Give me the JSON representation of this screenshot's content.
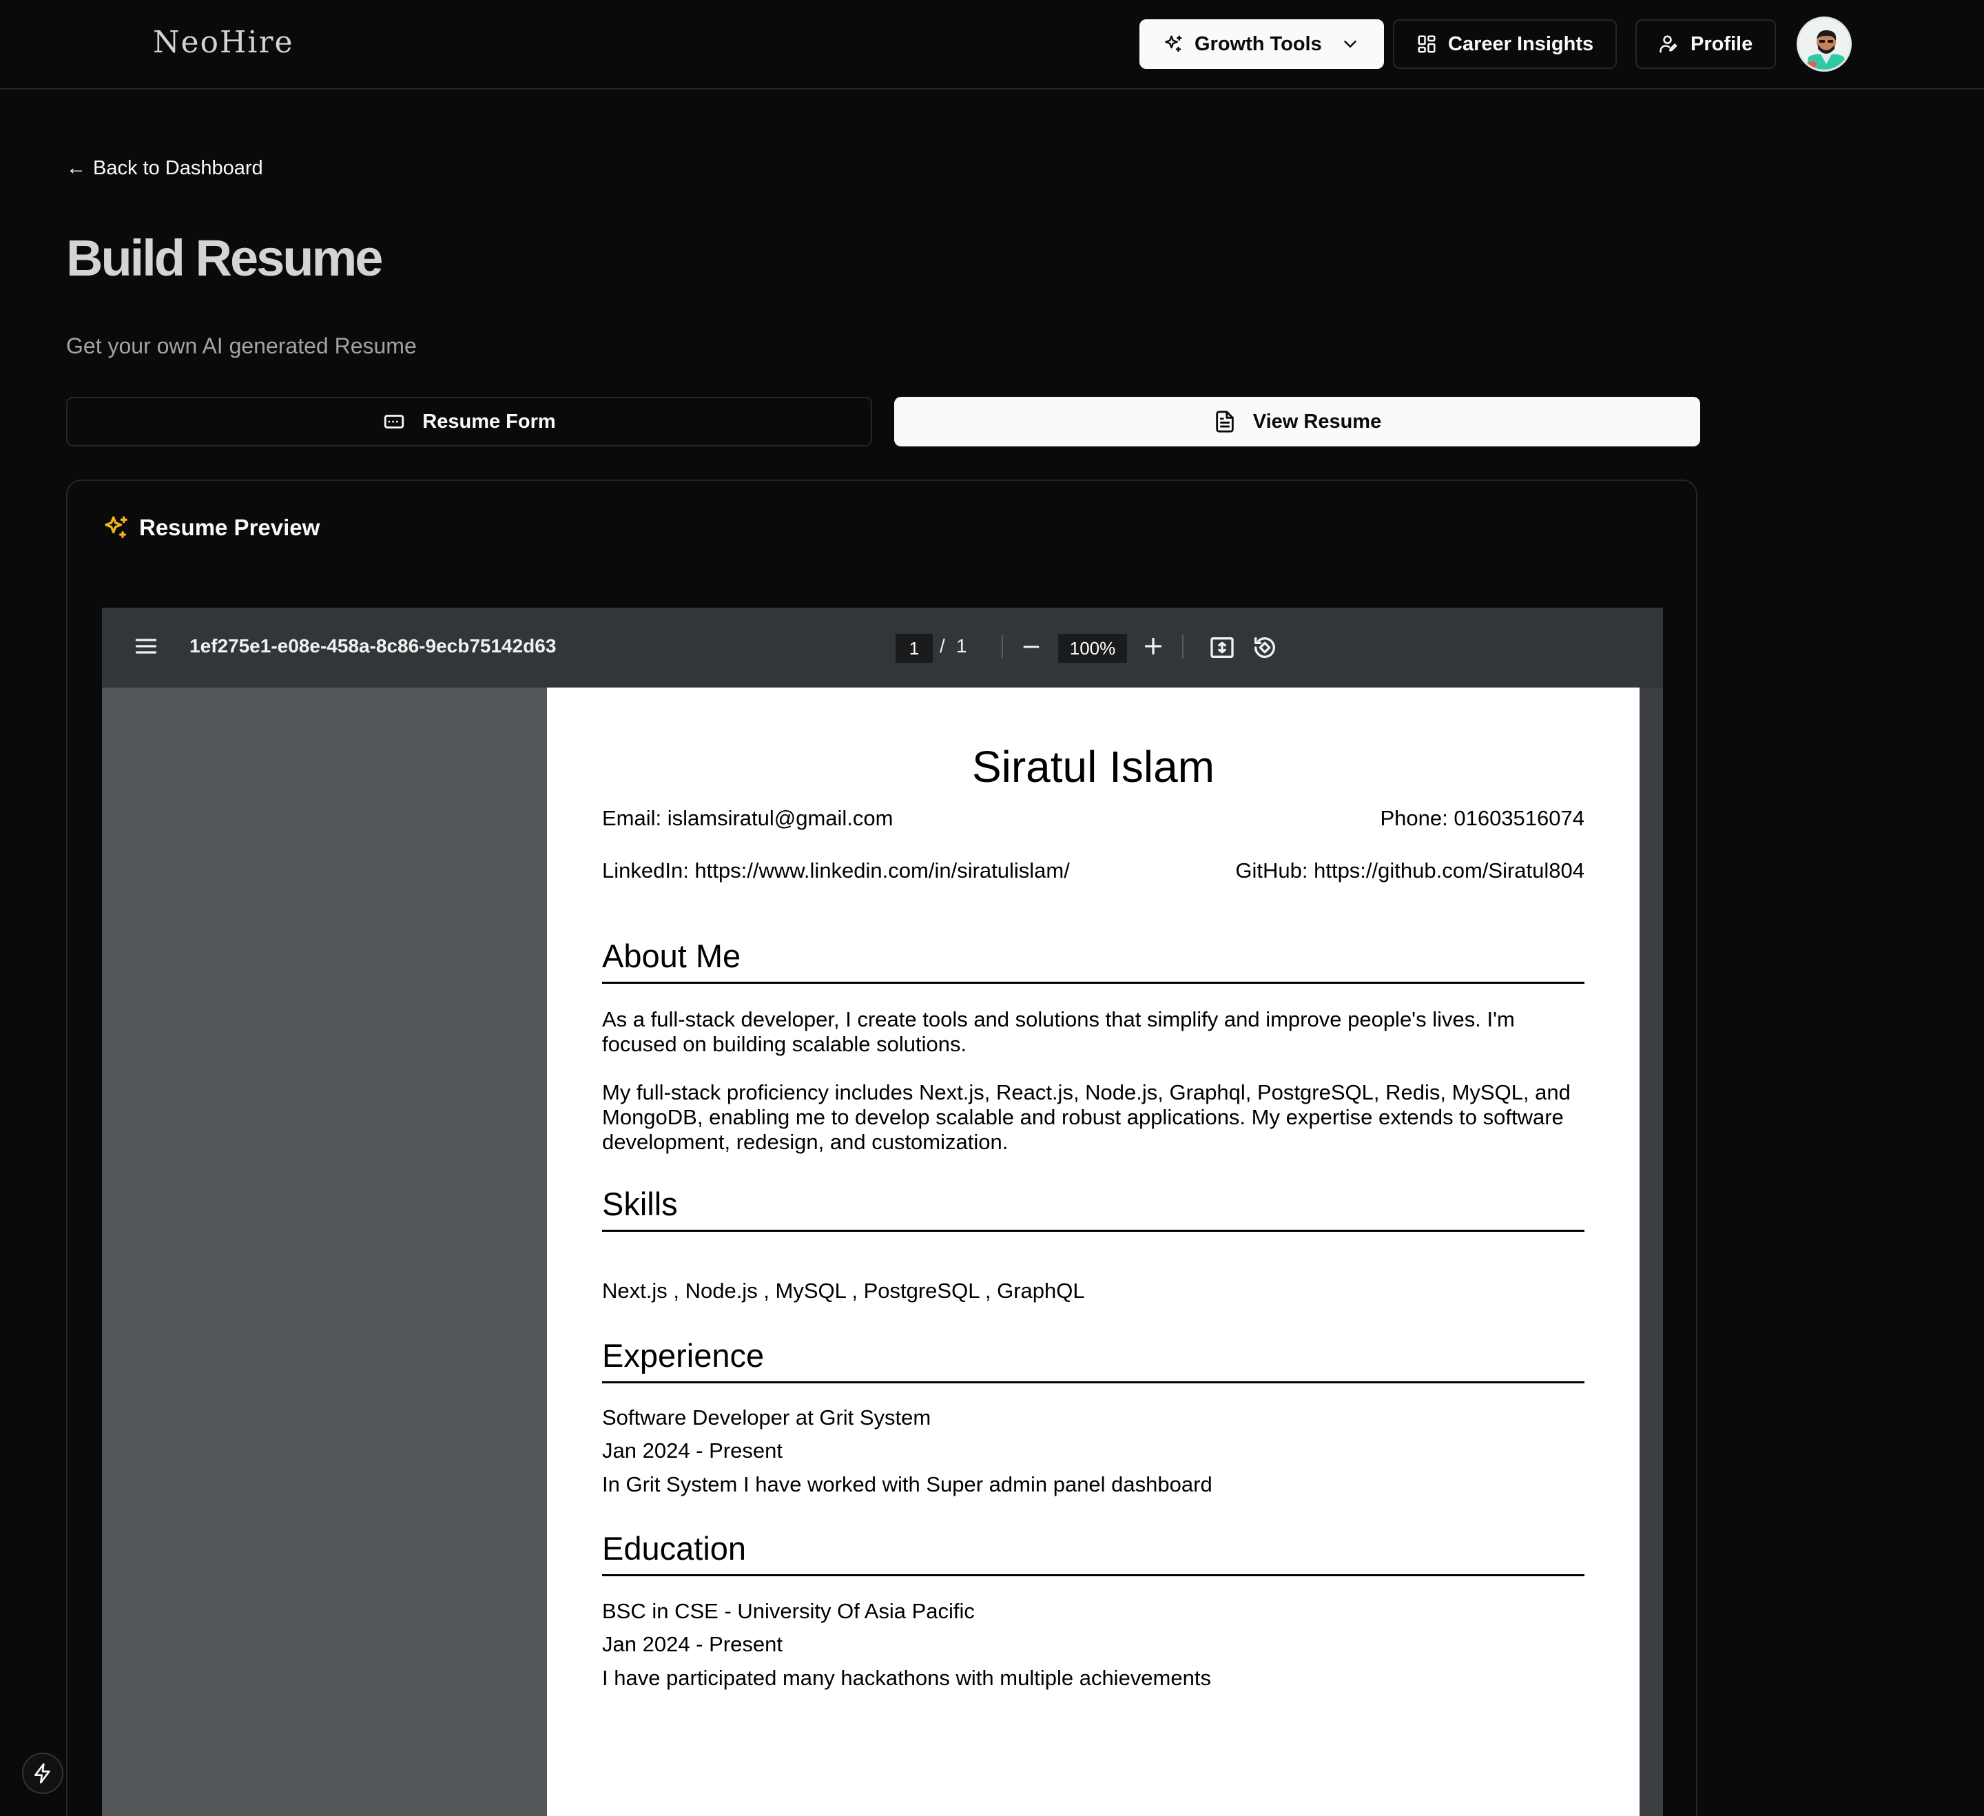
{
  "app": {
    "logo": "NeoHire"
  },
  "nav": {
    "growth_tools": "Growth Tools",
    "career_insights": "Career Insights",
    "profile": "Profile"
  },
  "header": {
    "back_link": "Back to Dashboard",
    "back_arrow": "←",
    "title": "Build Resume",
    "subtitle": "Get your own AI generated Resume"
  },
  "tabs": [
    {
      "label": "Resume Form",
      "icon": "form-icon",
      "active": false
    },
    {
      "label": "View Resume",
      "icon": "file-icon",
      "active": true
    }
  ],
  "card": {
    "title": "Resume Preview",
    "icon": "sparkles-icon",
    "icon_color": "#f5b31b"
  },
  "viewer": {
    "doc_name": "1ef275e1-e08e-458a-8c86-9ecb75142d63",
    "page_current": "1",
    "page_separator": "/",
    "page_total": "1",
    "zoom": "100%"
  },
  "resume": {
    "name": "Siratul Islam",
    "email": "Email: islamsiratul@gmail.com",
    "phone": "Phone: 01603516074",
    "linkedin": "LinkedIn: https://www.linkedin.com/in/siratulislam/",
    "github": "GitHub: https://github.com/Siratul804",
    "about_heading": "About Me",
    "about_p1": "As a full-stack developer, I create tools and solutions that simplify and improve people's lives. I'm focused on building scalable solutions.",
    "about_p2": "My full-stack proficiency includes Next.js, React.js, Node.js, Graphql, PostgreSQL, Redis, MySQL, and MongoDB, enabling me to develop scalable and robust applications. My expertise extends to software development, redesign, and customization.",
    "skills_heading": "Skills",
    "skills": "Next.js , Node.js , MySQL , PostgreSQL , GraphQL",
    "experience_heading": "Experience",
    "exp_title": "Software Developer at Grit System",
    "exp_dates": "Jan 2024 - Present",
    "exp_desc": "In Grit System I have worked with Super admin panel dashboard",
    "education_heading": "Education",
    "edu_title": "BSC in CSE - University Of Asia Pacific",
    "edu_dates": "Jan 2024 - Present",
    "edu_desc": "I have participated many hackathons with multiple achievements"
  },
  "colors": {
    "background": "#0a0a0a",
    "border": "#262626",
    "accent": "#f5b31b",
    "viewer_toolbar": "#323639",
    "viewer_bg": "#525659"
  }
}
